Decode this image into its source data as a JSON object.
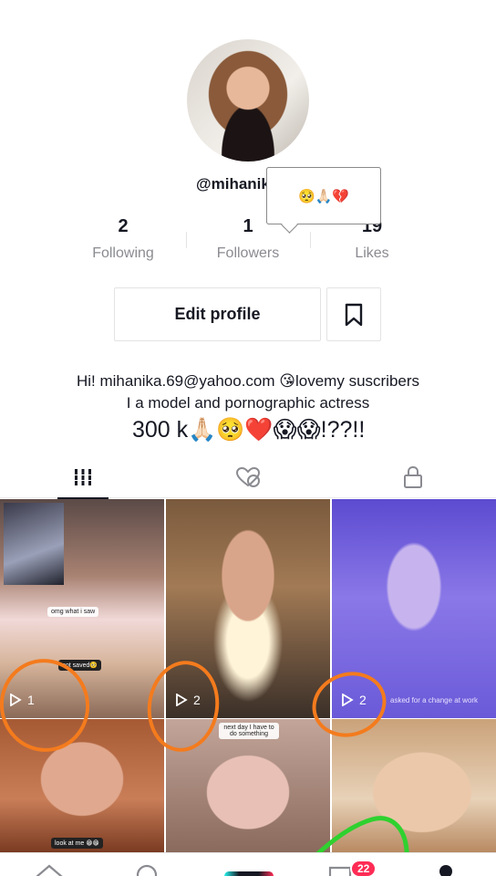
{
  "profile": {
    "username": "@mihanika.69",
    "tooltip_emoji": "🥺🙏🏻💔",
    "stats": [
      {
        "value": "2",
        "label": "Following"
      },
      {
        "value": "1",
        "label": "Followers"
      },
      {
        "value": "19",
        "label": "Likes"
      }
    ],
    "edit_label": "Edit profile",
    "bio_line1": "Hi! mihanika.69@yahoo.com 😘lovemy suscribers",
    "bio_line2": "I a model and pornographic actress",
    "bio_line3": "300 k🙏🏻🥺❤️😱😱!??!!"
  },
  "tabs": [
    {
      "icon": "grid-icon"
    },
    {
      "icon": "liked-hidden-icon"
    },
    {
      "icon": "lock-icon"
    }
  ],
  "videos": [
    {
      "views": "1",
      "caption": "omg what i saw",
      "sticker": "not saved🥺"
    },
    {
      "views": "2"
    },
    {
      "views": "2",
      "caption": "asked for a change at work"
    },
    {
      "caption": "look at me 😁😁"
    },
    {
      "caption": "next day I have to do something"
    },
    {}
  ],
  "nav": {
    "inbox_badge": "22"
  },
  "colors": {
    "annotation_orange": "#f47b1d",
    "annotation_green": "#2fd12f",
    "badge": "#fe2c55"
  }
}
